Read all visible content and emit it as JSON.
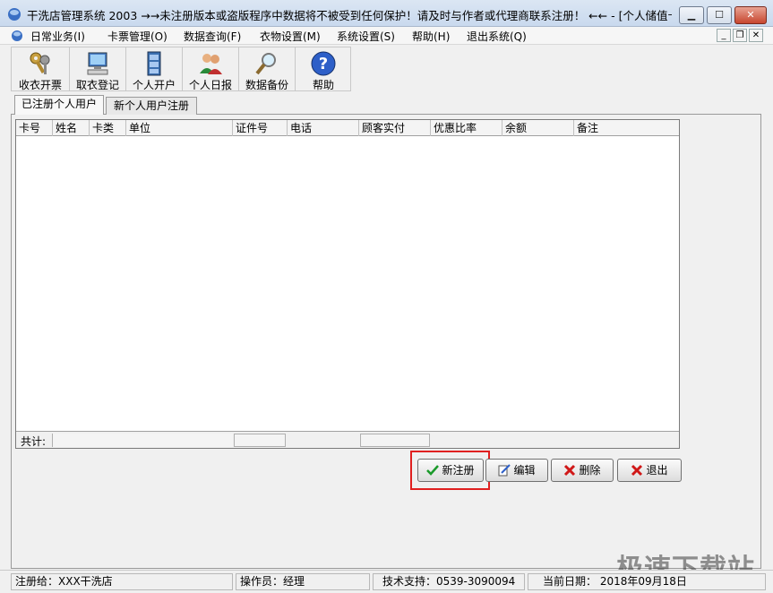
{
  "window": {
    "title": "干洗店管理系统 2003  →→未注册版本或盗版程序中数据将不被受到任何保护！请及时与作者或代理商联系注册！ ←← - [个人储值卡...",
    "minimize_label": "▁",
    "maximize_label": "☐",
    "close_label": "✕"
  },
  "menu": {
    "items": [
      "日常业务(I)",
      "卡票管理(O)",
      "数据查询(F)",
      "衣物设置(M)",
      "系统设置(S)",
      "帮助(H)",
      "退出系统(Q)"
    ],
    "mdi_min": "_",
    "mdi_max": "❐",
    "mdi_close": "✕"
  },
  "toolbar": {
    "buttons": [
      {
        "label": "收衣开票",
        "icon": "keys-icon"
      },
      {
        "label": "取衣登记",
        "icon": "computer-icon"
      },
      {
        "label": "个人开户",
        "icon": "cabinet-icon"
      },
      {
        "label": "个人日报",
        "icon": "users-icon"
      },
      {
        "label": "数据备份",
        "icon": "magnifier-icon"
      },
      {
        "label": "帮助",
        "icon": "help-icon"
      }
    ]
  },
  "tabs": [
    {
      "label": "已注册个人用户",
      "active": true
    },
    {
      "label": "新个人用户注册",
      "active": false
    }
  ],
  "grid": {
    "columns": [
      "卡号",
      "姓名",
      "卡类",
      "单位",
      "证件号",
      "电话",
      "顾客实付",
      "优惠比率",
      "余额",
      "备注"
    ],
    "rows": [],
    "footer_total": "共计:"
  },
  "actions": {
    "new": "新注册",
    "edit": "编辑",
    "delete": "删除",
    "exit": "退出"
  },
  "status": {
    "registered_to": "注册给：XXX干洗店",
    "operator": "操作员：经理",
    "support": "技术支持：0539-3090094",
    "date": "当前日期： 2018年09月18日"
  },
  "watermark": "极速下载站",
  "colors": {
    "highlight": "#e02020",
    "titlebar": "#c9d9ee"
  }
}
